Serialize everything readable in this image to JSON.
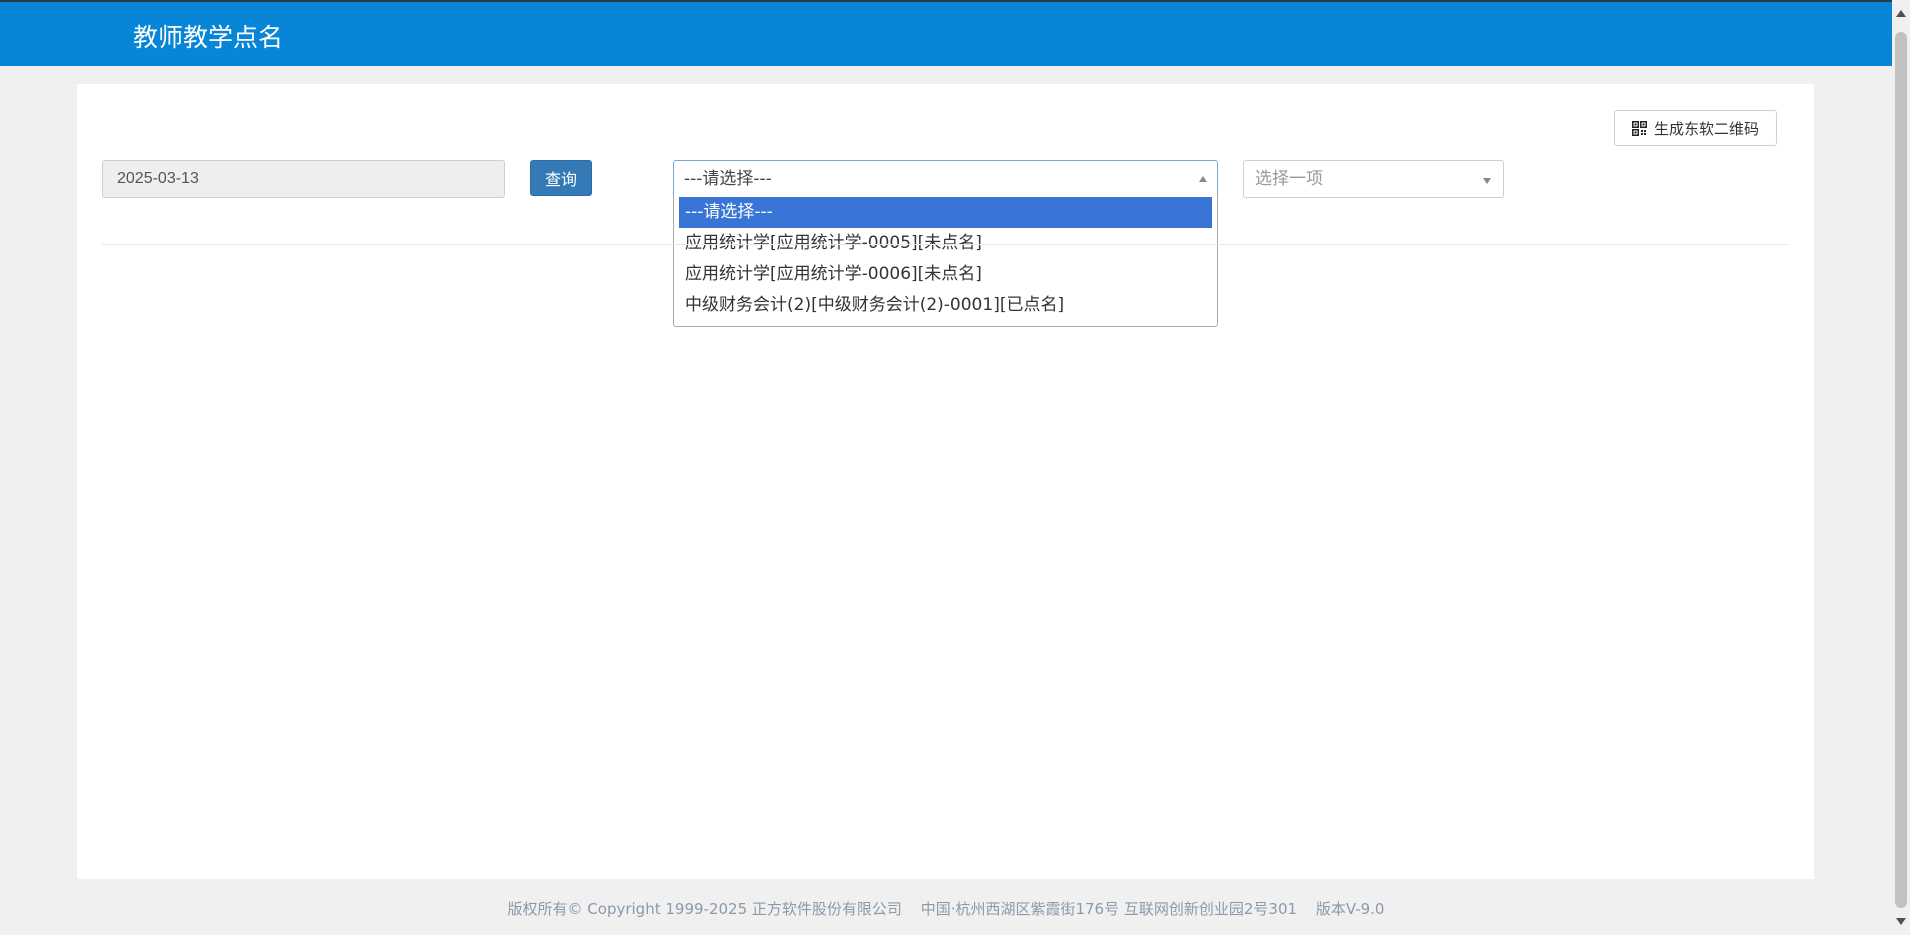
{
  "header": {
    "title": "教师教学点名"
  },
  "toolbar": {
    "qr_label": "生成东软二维码",
    "qr_icon": "qrcode-icon",
    "date_value": "2025-03-13",
    "query_label": "查询"
  },
  "course_select": {
    "value": "---请选择---",
    "options": [
      {
        "label": "---请选择---",
        "selected": true
      },
      {
        "label": "应用统计学[应用统计学-0005][未点名]",
        "selected": false
      },
      {
        "label": "应用统计学[应用统计学-0006][未点名]",
        "selected": false
      },
      {
        "label": "中级财务会计(2)[中级财务会计(2)-0001][已点名]",
        "selected": false
      }
    ]
  },
  "second_select": {
    "placeholder": "选择一项"
  },
  "footer": {
    "copyright": "版权所有© Copyright 1999-2025 正方软件股份有限公司",
    "address": "中国·杭州西湖区紫霞街176号 互联网创新创业园2号301",
    "version": "版本V-9.0"
  },
  "colors": {
    "header_bg": "#0785d6",
    "primary_button": "#337ab7",
    "option_selected": "#3875d7"
  }
}
